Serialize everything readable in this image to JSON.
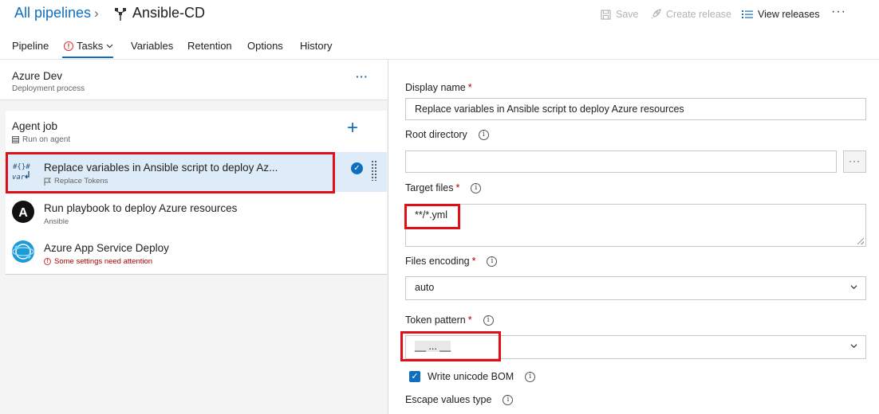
{
  "header": {
    "breadcrumb_root": "All pipelines",
    "pipeline_name": "Ansible-CD",
    "toolbar": {
      "save_label": "Save",
      "create_release_label": "Create release",
      "view_releases_label": "View releases",
      "more_label": "···"
    }
  },
  "tabs": [
    {
      "label": "Pipeline"
    },
    {
      "label": "Tasks",
      "selected": true,
      "has_warning": true
    },
    {
      "label": "Variables"
    },
    {
      "label": "Retention"
    },
    {
      "label": "Options"
    },
    {
      "label": "History"
    }
  ],
  "stage": {
    "name": "Azure Dev",
    "subtitle": "Deployment process",
    "more_label": "···"
  },
  "agent_job": {
    "name": "Agent job",
    "subtitle": "Run on agent",
    "add_label": "+"
  },
  "tasks": [
    {
      "name": "Replace variables in Ansible script to deploy Az...",
      "subtitle": "Replace Tokens",
      "icon": "replace-tokens-icon",
      "icon_text_top": "#{}#",
      "icon_text_bottom": "var",
      "selected": true
    },
    {
      "name": "Run playbook to deploy Azure resources",
      "subtitle": "Ansible",
      "icon": "ansible-icon",
      "icon_letter": "A"
    },
    {
      "name": "Azure App Service Deploy",
      "subtitle": "Some settings need attention",
      "icon": "azure-app-service-icon",
      "warning": true
    }
  ],
  "form": {
    "display_name": {
      "label": "Display name",
      "required": true,
      "value": "Replace variables in Ansible script to deploy Azure resources"
    },
    "root_directory": {
      "label": "Root directory",
      "required": false,
      "value": "",
      "browse_label": "···"
    },
    "target_files": {
      "label": "Target files",
      "required": true,
      "value": "**/*.yml"
    },
    "files_encoding": {
      "label": "Files encoding",
      "required": true,
      "value": "auto"
    },
    "token_pattern": {
      "label": "Token pattern",
      "required": true,
      "value": "__ ... __"
    },
    "write_unicode_bom": {
      "label": "Write unicode BOM",
      "checked": true
    },
    "escape_values_type": {
      "label": "Escape values type"
    }
  },
  "colors": {
    "accent": "#106ebe",
    "highlight_box": "#e0101a",
    "selected_row": "#deecf9",
    "warning": "#a80000"
  }
}
